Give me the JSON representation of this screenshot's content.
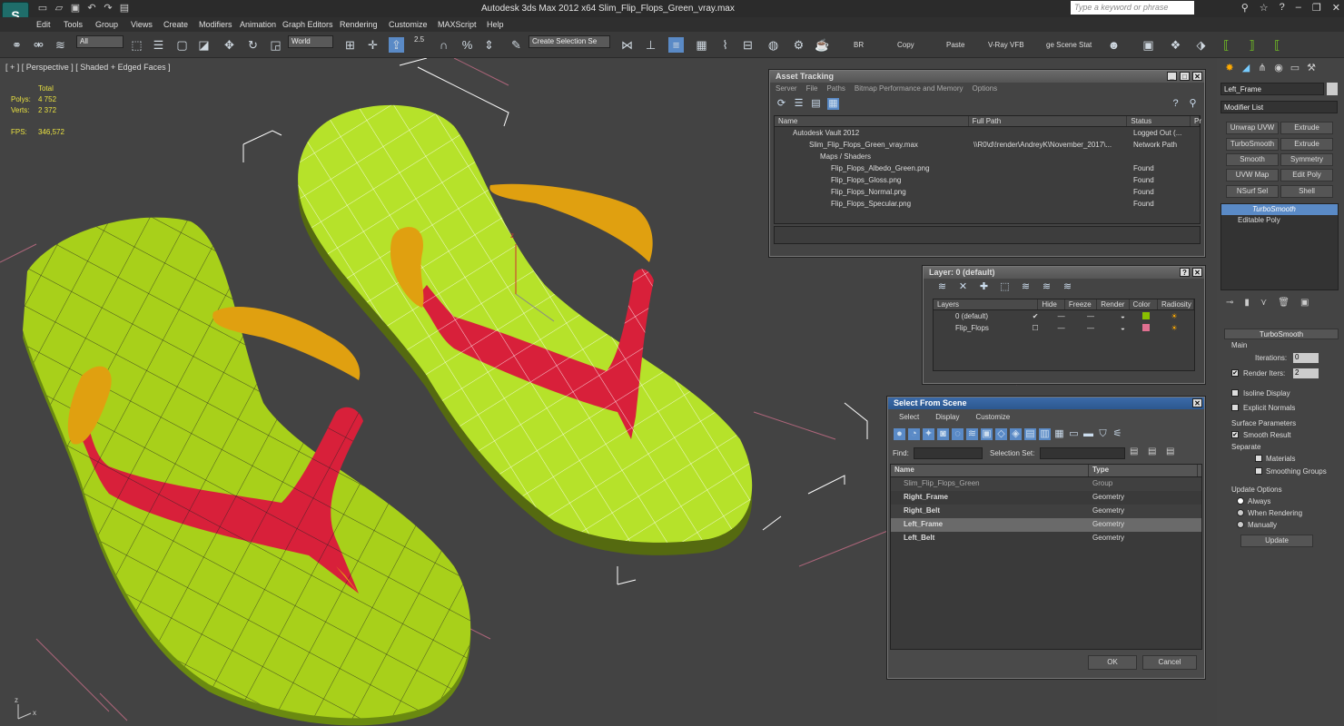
{
  "app": {
    "title": "Autodesk 3ds Max  2012 x64     Slim_Flip_Flops_Green_vray.max",
    "search_placeholder": "Type a keyword or phrase"
  },
  "menu": [
    "Edit",
    "Tools",
    "Group",
    "Views",
    "Create",
    "Modifiers",
    "Animation",
    "Graph Editors",
    "Rendering",
    "Customize",
    "MAXScript",
    "Help"
  ],
  "toolbar": {
    "filter": "All",
    "coord": "World",
    "selection_set": "Create Selection Se",
    "btn_br": "BR",
    "btn_copy": "Copy",
    "btn_paste": "Paste",
    "btn_vfb": "V-Ray VFB",
    "btn_stat": "ge Scene Stat",
    "snap_num": "2.5"
  },
  "viewport": {
    "label": "[ + ] [ Perspective ] [ Shaded + Edged Faces ]",
    "stats": {
      "header": "Total",
      "polys_label": "Polys:",
      "polys": "4 752",
      "verts_label": "Verts:",
      "verts": "2 372",
      "fps_label": "FPS:",
      "fps": "346,572"
    },
    "axis_z": "z",
    "gizmo_z": "z",
    "gizmo_x": "x"
  },
  "asset_tracking": {
    "title": "Asset Tracking",
    "menu": [
      "Server",
      "File",
      "Paths",
      "Bitmap Performance and Memory",
      "Options"
    ],
    "columns": [
      "Name",
      "Full Path",
      "Status",
      "Pr"
    ],
    "rows": [
      {
        "name": "Autodesk Vault 2012",
        "path": "",
        "status": "Logged Out (...",
        "indent": 1
      },
      {
        "name": "Slim_Flip_Flops_Green_vray.max",
        "path": "\\\\R0\\d\\!render\\AndreyK\\November_2017\\...",
        "status": "Network Path",
        "indent": 2
      },
      {
        "name": "Maps / Shaders",
        "path": "",
        "status": "",
        "indent": 3
      },
      {
        "name": "Flip_Flops_Albedo_Green.png",
        "path": "",
        "status": "Found",
        "indent": 4
      },
      {
        "name": "Flip_Flops_Gloss.png",
        "path": "",
        "status": "Found",
        "indent": 4
      },
      {
        "name": "Flip_Flops_Normal.png",
        "path": "",
        "status": "Found",
        "indent": 4
      },
      {
        "name": "Flip_Flops_Specular.png",
        "path": "",
        "status": "Found",
        "indent": 4
      }
    ]
  },
  "layer_panel": {
    "title": "Layer: 0 (default)",
    "columns": [
      "Layers",
      "Hide",
      "Freeze",
      "Render",
      "Color",
      "Radiosity"
    ],
    "rows": [
      {
        "name": "0 (default)",
        "color": "#8ac000",
        "checked": "✔"
      },
      {
        "name": "Flip_Flops",
        "color": "#e07090",
        "checked": ""
      }
    ]
  },
  "select_scene": {
    "title": "Select From Scene",
    "menu": [
      "Select",
      "Display",
      "Customize"
    ],
    "find_label": "Find:",
    "selset_label": "Selection Set:",
    "columns": [
      "Name",
      "Type"
    ],
    "rows": [
      {
        "name": "Slim_Flip_Flops_Green",
        "type": "Group"
      },
      {
        "name": "Right_Frame",
        "type": "Geometry"
      },
      {
        "name": "Right_Belt",
        "type": "Geometry"
      },
      {
        "name": "Left_Frame",
        "type": "Geometry"
      },
      {
        "name": "Left_Belt",
        "type": "Geometry"
      }
    ],
    "ok": "OK",
    "cancel": "Cancel"
  },
  "command_panel": {
    "object_name": "Left_Frame",
    "modifier_list": "Modifier List",
    "mod_buttons": [
      "Unwrap UVW",
      "Extrude",
      "TurboSmooth",
      "Extrude",
      "Smooth",
      "Symmetry",
      "UVW Map",
      "Edit Poly",
      "NSurf Sel",
      "Shell"
    ],
    "stack": [
      "TurboSmooth",
      "Editable Poly"
    ],
    "rollout_title": "TurboSmooth",
    "main_label": "Main",
    "iterations_label": "Iterations:",
    "iterations": "0",
    "render_iters_label": "Render Iters:",
    "render_iters": "2",
    "isoline": "Isoline Display",
    "explicit": "Explicit Normals",
    "surface_params": "Surface Parameters",
    "smooth_result": "Smooth Result",
    "separate": "Separate",
    "materials": "Materials",
    "smoothing_groups": "Smoothing Groups",
    "update_options": "Update Options",
    "always": "Always",
    "when_rendering": "When Rendering",
    "manually": "Manually",
    "update_btn": "Update"
  },
  "colors": {
    "sole": "#a8d01a",
    "strap_red": "#d8203a",
    "strap_yellow": "#e0a010",
    "wire": "#ffffff",
    "background": "#434343"
  }
}
